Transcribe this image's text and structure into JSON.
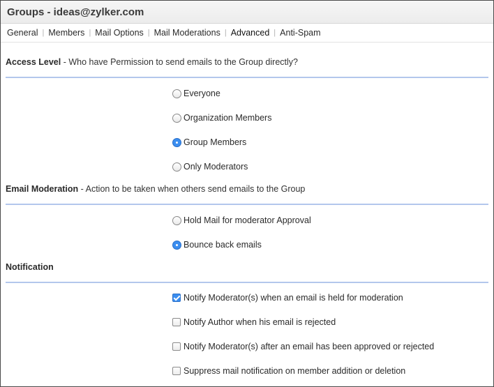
{
  "header": {
    "title": "Groups - ideas@zylker.com"
  },
  "tabs": [
    {
      "label": "General"
    },
    {
      "label": "Members"
    },
    {
      "label": "Mail Options"
    },
    {
      "label": "Mail Moderations"
    },
    {
      "label": "Advanced",
      "active": true
    },
    {
      "label": "Anti-Spam"
    }
  ],
  "access_level": {
    "title": "Access Level",
    "description": " - Who have Permission to send emails to the Group directly?",
    "options": [
      {
        "label": "Everyone",
        "selected": false
      },
      {
        "label": "Organization Members",
        "selected": false
      },
      {
        "label": "Group Members",
        "selected": true
      },
      {
        "label": "Only Moderators",
        "selected": false
      }
    ]
  },
  "email_moderation": {
    "title": "Email Moderation",
    "description": " - Action to be taken when others send emails to the Group",
    "options": [
      {
        "label": "Hold Mail for moderator Approval",
        "selected": false
      },
      {
        "label": "Bounce back emails",
        "selected": true
      }
    ]
  },
  "notification": {
    "title": "Notification",
    "options": [
      {
        "label": "Notify Moderator(s) when an email is held for moderation",
        "checked": true
      },
      {
        "label": "Notify Author when his email is rejected",
        "checked": false
      },
      {
        "label": "Notify Moderator(s) after an email has been approved or rejected",
        "checked": false
      },
      {
        "label": "Suppress mail notification on member addition or deletion",
        "checked": false
      }
    ]
  },
  "colors": {
    "accent": "#3b8ef0",
    "rule": "#b3c7ec"
  }
}
